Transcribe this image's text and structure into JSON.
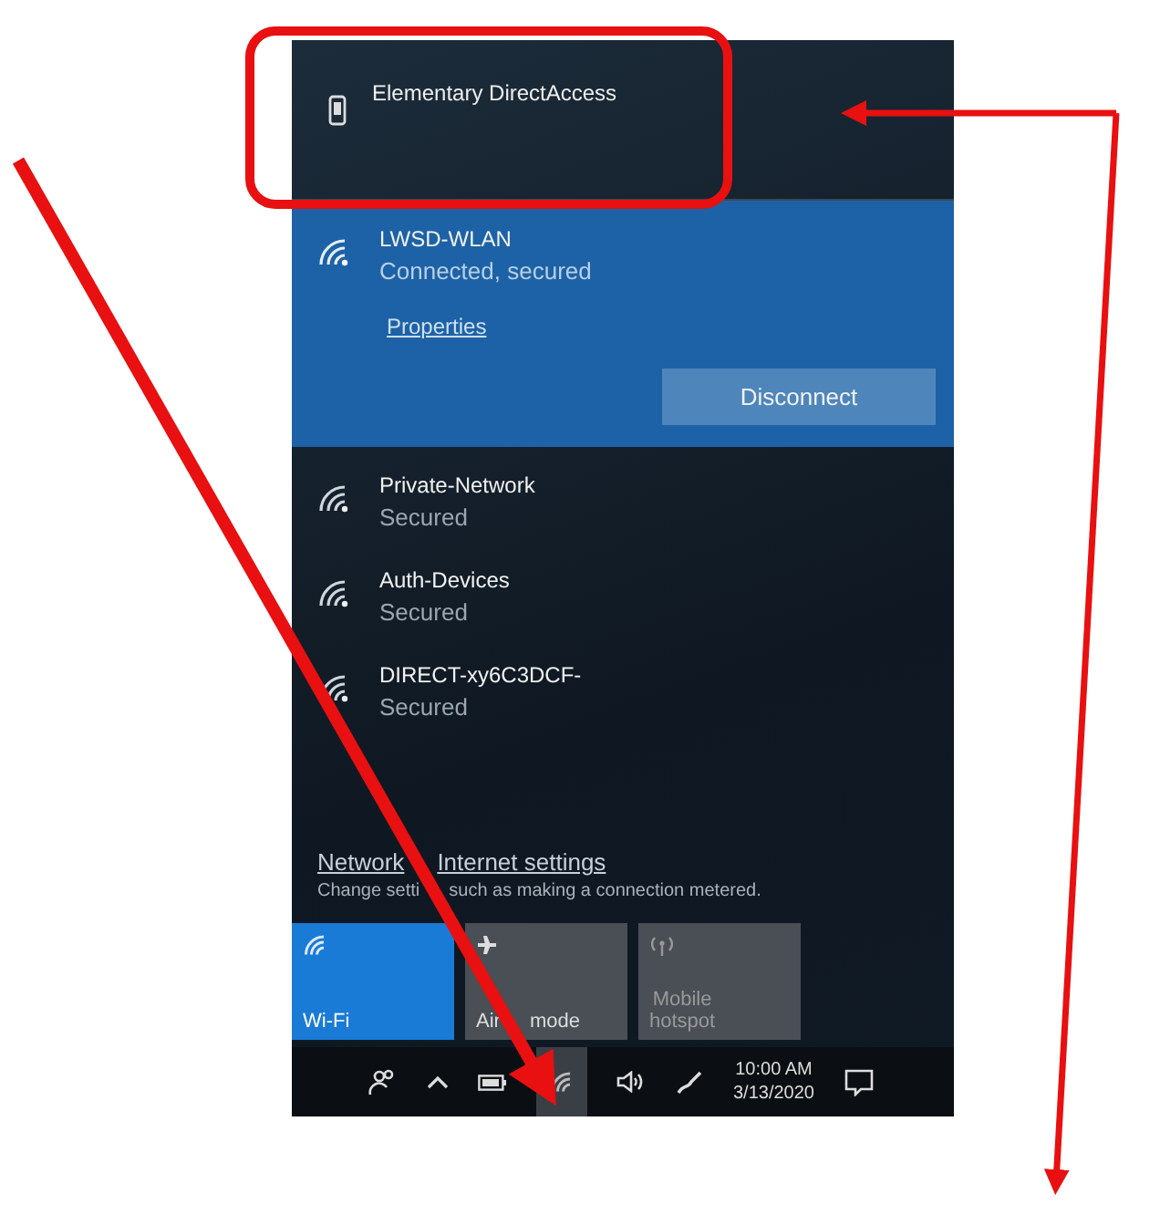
{
  "device": {
    "name": "Elementary DirectAccess"
  },
  "connected": {
    "name": "LWSD-WLAN",
    "status": "Connected, secured",
    "link": "Properties",
    "button": "Disconnect"
  },
  "networks": [
    {
      "name": "Private-Network",
      "status": "Secured"
    },
    {
      "name": "Auth-Devices",
      "status": "Secured"
    },
    {
      "name": "DIRECT-xy6C3DCF-",
      "status": "Secured"
    }
  ],
  "settings": {
    "link_parts": [
      "Network",
      "Internet settings"
    ],
    "description_parts": [
      "Change setti",
      "such as making a connection metered."
    ]
  },
  "tiles": [
    {
      "kind": "wifi",
      "label_parts": [
        "Wi-Fi"
      ],
      "on": true
    },
    {
      "kind": "airplane",
      "label_parts": [
        "Air",
        "mode"
      ],
      "on": false
    },
    {
      "kind": "hotspot",
      "label_parts": [
        "Mobile",
        "hotspot"
      ],
      "on": false
    }
  ],
  "taskbar": {
    "time": "10:00 AM",
    "date": "3/13/2020",
    "network_selected": true
  }
}
